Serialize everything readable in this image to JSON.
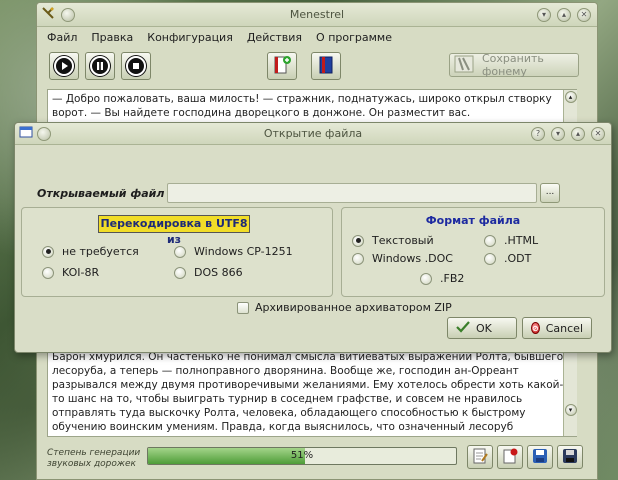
{
  "main_window": {
    "title": "Menestrel",
    "menu": [
      "Файл",
      "Правка",
      "Конфигурация",
      "Действия",
      "О программе"
    ],
    "save_phoneme_label": "Сохранить фонему",
    "top_text": "— Добро пожаловать, ваша милость! — стражник, поднатужась, широко открыл створку ворот. — Вы найдете господина дворецкого в донжоне. Он разместит вас.",
    "bottom_text": "Барон хмурился. Он частенько не понимал смысла витиеватых выражений Ролта, бывшего лесоруба, а теперь — полноправного дворянина. Вообще же, господин ан-Орреант разрывался между двумя противоречивыми желаниями. Ему хотелось обрести хоть какой-то шанс на то, чтобы выиграть турнир в соседнем графстве, и совсем не нравилось отправлять туда выскочку Ролта, человека, обладающего способностью к быстрому обучению воинским умениям. Правда, когда выяснилось, что означенный лесоруб принадлежит к неизвестному дворянскому роду, с плеч",
    "generation_label": "Степень генерации звуковых дорожек",
    "progress_percent": 51,
    "progress_text": "51%"
  },
  "dialog": {
    "title": "Открытие файла",
    "file_label": "Открываемый файл",
    "file_value": "",
    "browse_label": "...",
    "encoding_group": {
      "title": "Перекодировка в UTF8 из",
      "options": [
        "не требуется",
        "Windows CP-1251",
        "KOI-8R",
        "DOS 866"
      ],
      "selected": "не требуется"
    },
    "format_group": {
      "title": "Формат файла",
      "options": [
        "Текстовый",
        ".HTML",
        "Windows .DOC",
        ".ODT",
        ".FB2"
      ],
      "selected": "Текстовый"
    },
    "zip_label": "Архивированное архиватором ZIP",
    "ok_label": "OK",
    "cancel_label": "Cancel"
  }
}
